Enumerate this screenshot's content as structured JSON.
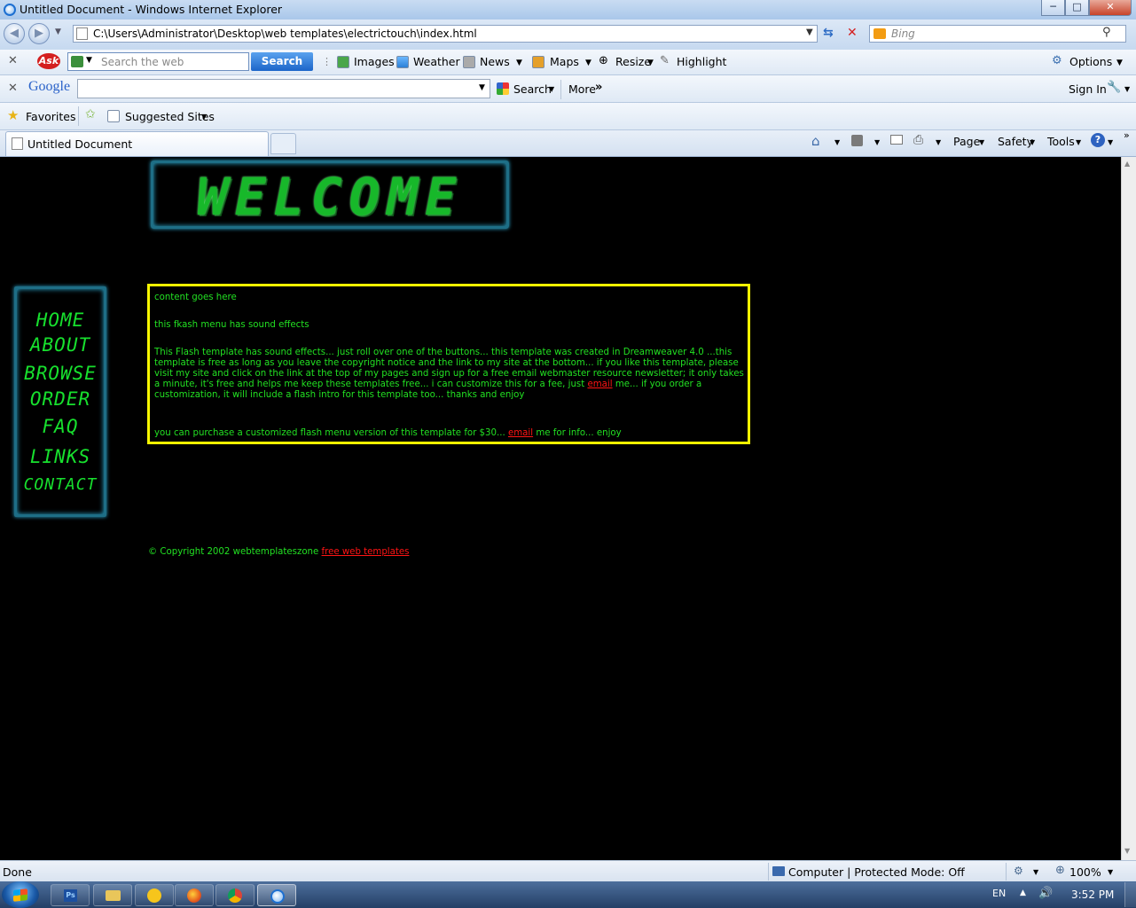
{
  "window": {
    "title": "Untitled Document - Windows Internet Explorer",
    "min": "─",
    "max": "□",
    "close": "✕"
  },
  "nav": {
    "address": "C:\\Users\\Administrator\\Desktop\\web templates\\electrictouch\\index.html",
    "search_placeholder": "Bing"
  },
  "ask_toolbar": {
    "search_placeholder": "Search the web",
    "search_button": "Search",
    "items": [
      "Images",
      "Weather",
      "News",
      "Maps",
      "Resize",
      "Highlight"
    ],
    "options": "Options"
  },
  "google_toolbar": {
    "logo": "Google",
    "search": "Search",
    "more": "More",
    "sign_in": "Sign In"
  },
  "favorites_bar": {
    "favorites": "Favorites",
    "suggested": "Suggested Sites"
  },
  "tab": {
    "title": "Untitled Document"
  },
  "command_bar": {
    "page": "Page",
    "safety": "Safety",
    "tools": "Tools"
  },
  "page": {
    "banner": "WELCOME",
    "menu": [
      "HOME",
      "ABOUT",
      "BROWSE",
      "ORDER",
      "FAQ",
      "LINKS",
      "CONTACT"
    ],
    "content_line1": "content goes here",
    "content_line2": "this fkash menu has sound effects",
    "para_before_link": "This Flash template has sound effects... just roll over one of the buttons... this template was created in Dreamweaver 4.0 ...this template is free as long as you leave the copyright notice and the link to my site at the bottom... if you like this template, please visit my site and click on the link at the top of my pages and sign up for a free email webmaster resource newsletter; it only takes a minute, it's free and helps me keep these templates free... i can customize this for a fee, just ",
    "email_link": "email",
    "para_after_link": " me... if you order a customization, it will include a flash intro for this template too... thanks and enjoy",
    "purchase_before": "you can purchase a customized flash menu version of this template for $30... ",
    "purchase_after": " me for info... enjoy",
    "copyright": "© Copyright 2002 webtemplateszone ",
    "copyright_link": "free web templates"
  },
  "status": {
    "text": "Done",
    "zone": "Computer | Protected Mode: Off",
    "zoom": "100%"
  },
  "taskbar": {
    "lang": "EN",
    "time": "3:52 PM"
  },
  "colors": {
    "neon_green": "#22e022",
    "border_yellow": "#f6f600",
    "link_red": "#ff1414",
    "frame_cyan": "#1e6e86"
  }
}
